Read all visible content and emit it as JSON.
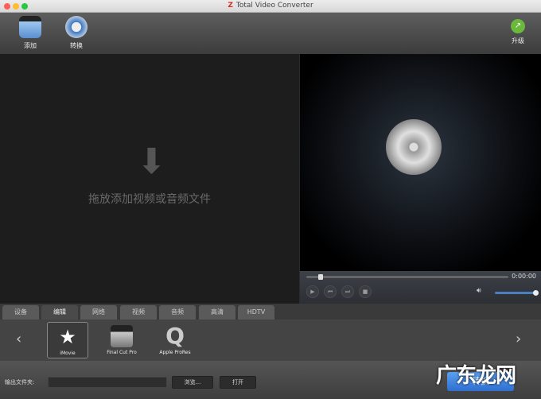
{
  "window": {
    "title": "Total Video Converter",
    "title_logo": "Z"
  },
  "toolbar": {
    "add": "添加",
    "convert": "转换",
    "upgrade": "升级"
  },
  "drop_area": {
    "text": "拖放添加视频或音频文件"
  },
  "player": {
    "time": "0:00:00",
    "progress": 0.06,
    "volume": 1.0
  },
  "tabs": [
    "设备",
    "编辑",
    "网络",
    "视频",
    "音频",
    "高清",
    "HDTV"
  ],
  "active_tab": 1,
  "presets": [
    {
      "label": "iMovie"
    },
    {
      "label": "Final Cut Pro"
    },
    {
      "label": "Apple ProRes"
    }
  ],
  "output": {
    "label": "输出文件夹:",
    "value": "",
    "browse": "浏览...",
    "open": "打开",
    "convert": "转换"
  },
  "watermark": "广东龙网"
}
